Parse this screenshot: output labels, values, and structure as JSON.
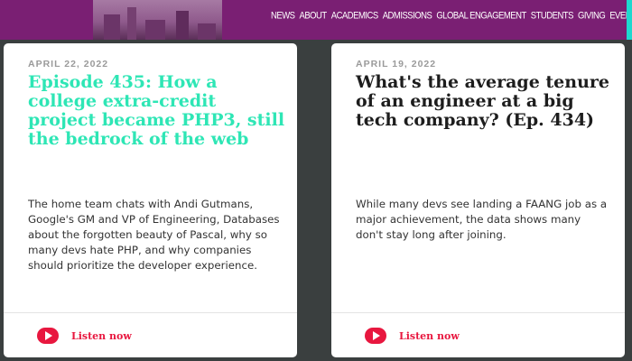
{
  "nav": {
    "items": [
      "NEWS",
      "ABOUT",
      "ACADEMICS",
      "ADMISSIONS",
      "GLOBAL ENGAGEMENT",
      "STUDENTS",
      "GIVING",
      "EVENTS"
    ]
  },
  "cards": [
    {
      "date": "APRIL 22, 2022",
      "title": "Episode 435: How a college extra-credit project became PHP3, still the bedrock of the web",
      "excerpt": "The home team chats with Andi Gutmans, Google's GM and VP of Engineering, Databases about the forgotten beauty of Pascal, why so many devs hate PHP, and why companies should prioritize the developer experience.",
      "listen_label": "Listen now"
    },
    {
      "date": "APRIL 19, 2022",
      "title": "What's the average tenure of an engineer at a big tech company? (Ep. 434)",
      "excerpt": "While many devs see landing a FAANG job as a major achievement, the data shows many don't stay long after joining.",
      "listen_label": "Listen now"
    }
  ],
  "colors": {
    "topbar": "#7a1f73",
    "page_background": "#3a3f3f",
    "title_accent": "#2ee6b5",
    "play_button": "#e8173f"
  },
  "icons": {
    "play": "play-icon"
  }
}
